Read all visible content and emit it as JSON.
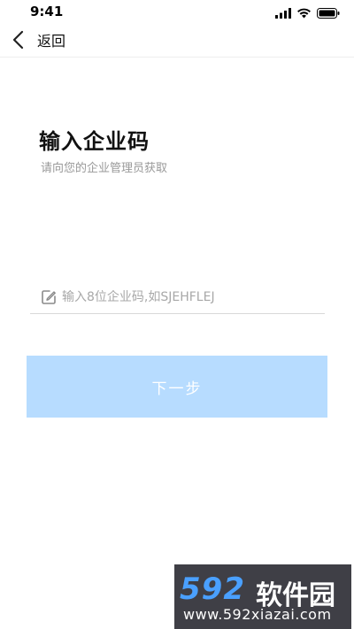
{
  "status_bar": {
    "time": "9:41",
    "icons": [
      "signal-icon",
      "wifi-icon",
      "battery-icon"
    ]
  },
  "nav": {
    "back_label": "返回",
    "back_icon": "chevron-left-icon"
  },
  "main": {
    "title": "输入企业码",
    "subtitle": "请向您的企业管理员获取",
    "code_input": {
      "placeholder": "输入8位企业码,如SJEHFLEJ",
      "value": "",
      "icon": "edit-icon"
    },
    "next_button_label": "下一步",
    "accent_color": "#b7dcff"
  },
  "watermark": {
    "logo": "592",
    "brand": "软件园",
    "url": "www.592xiazai.com"
  }
}
